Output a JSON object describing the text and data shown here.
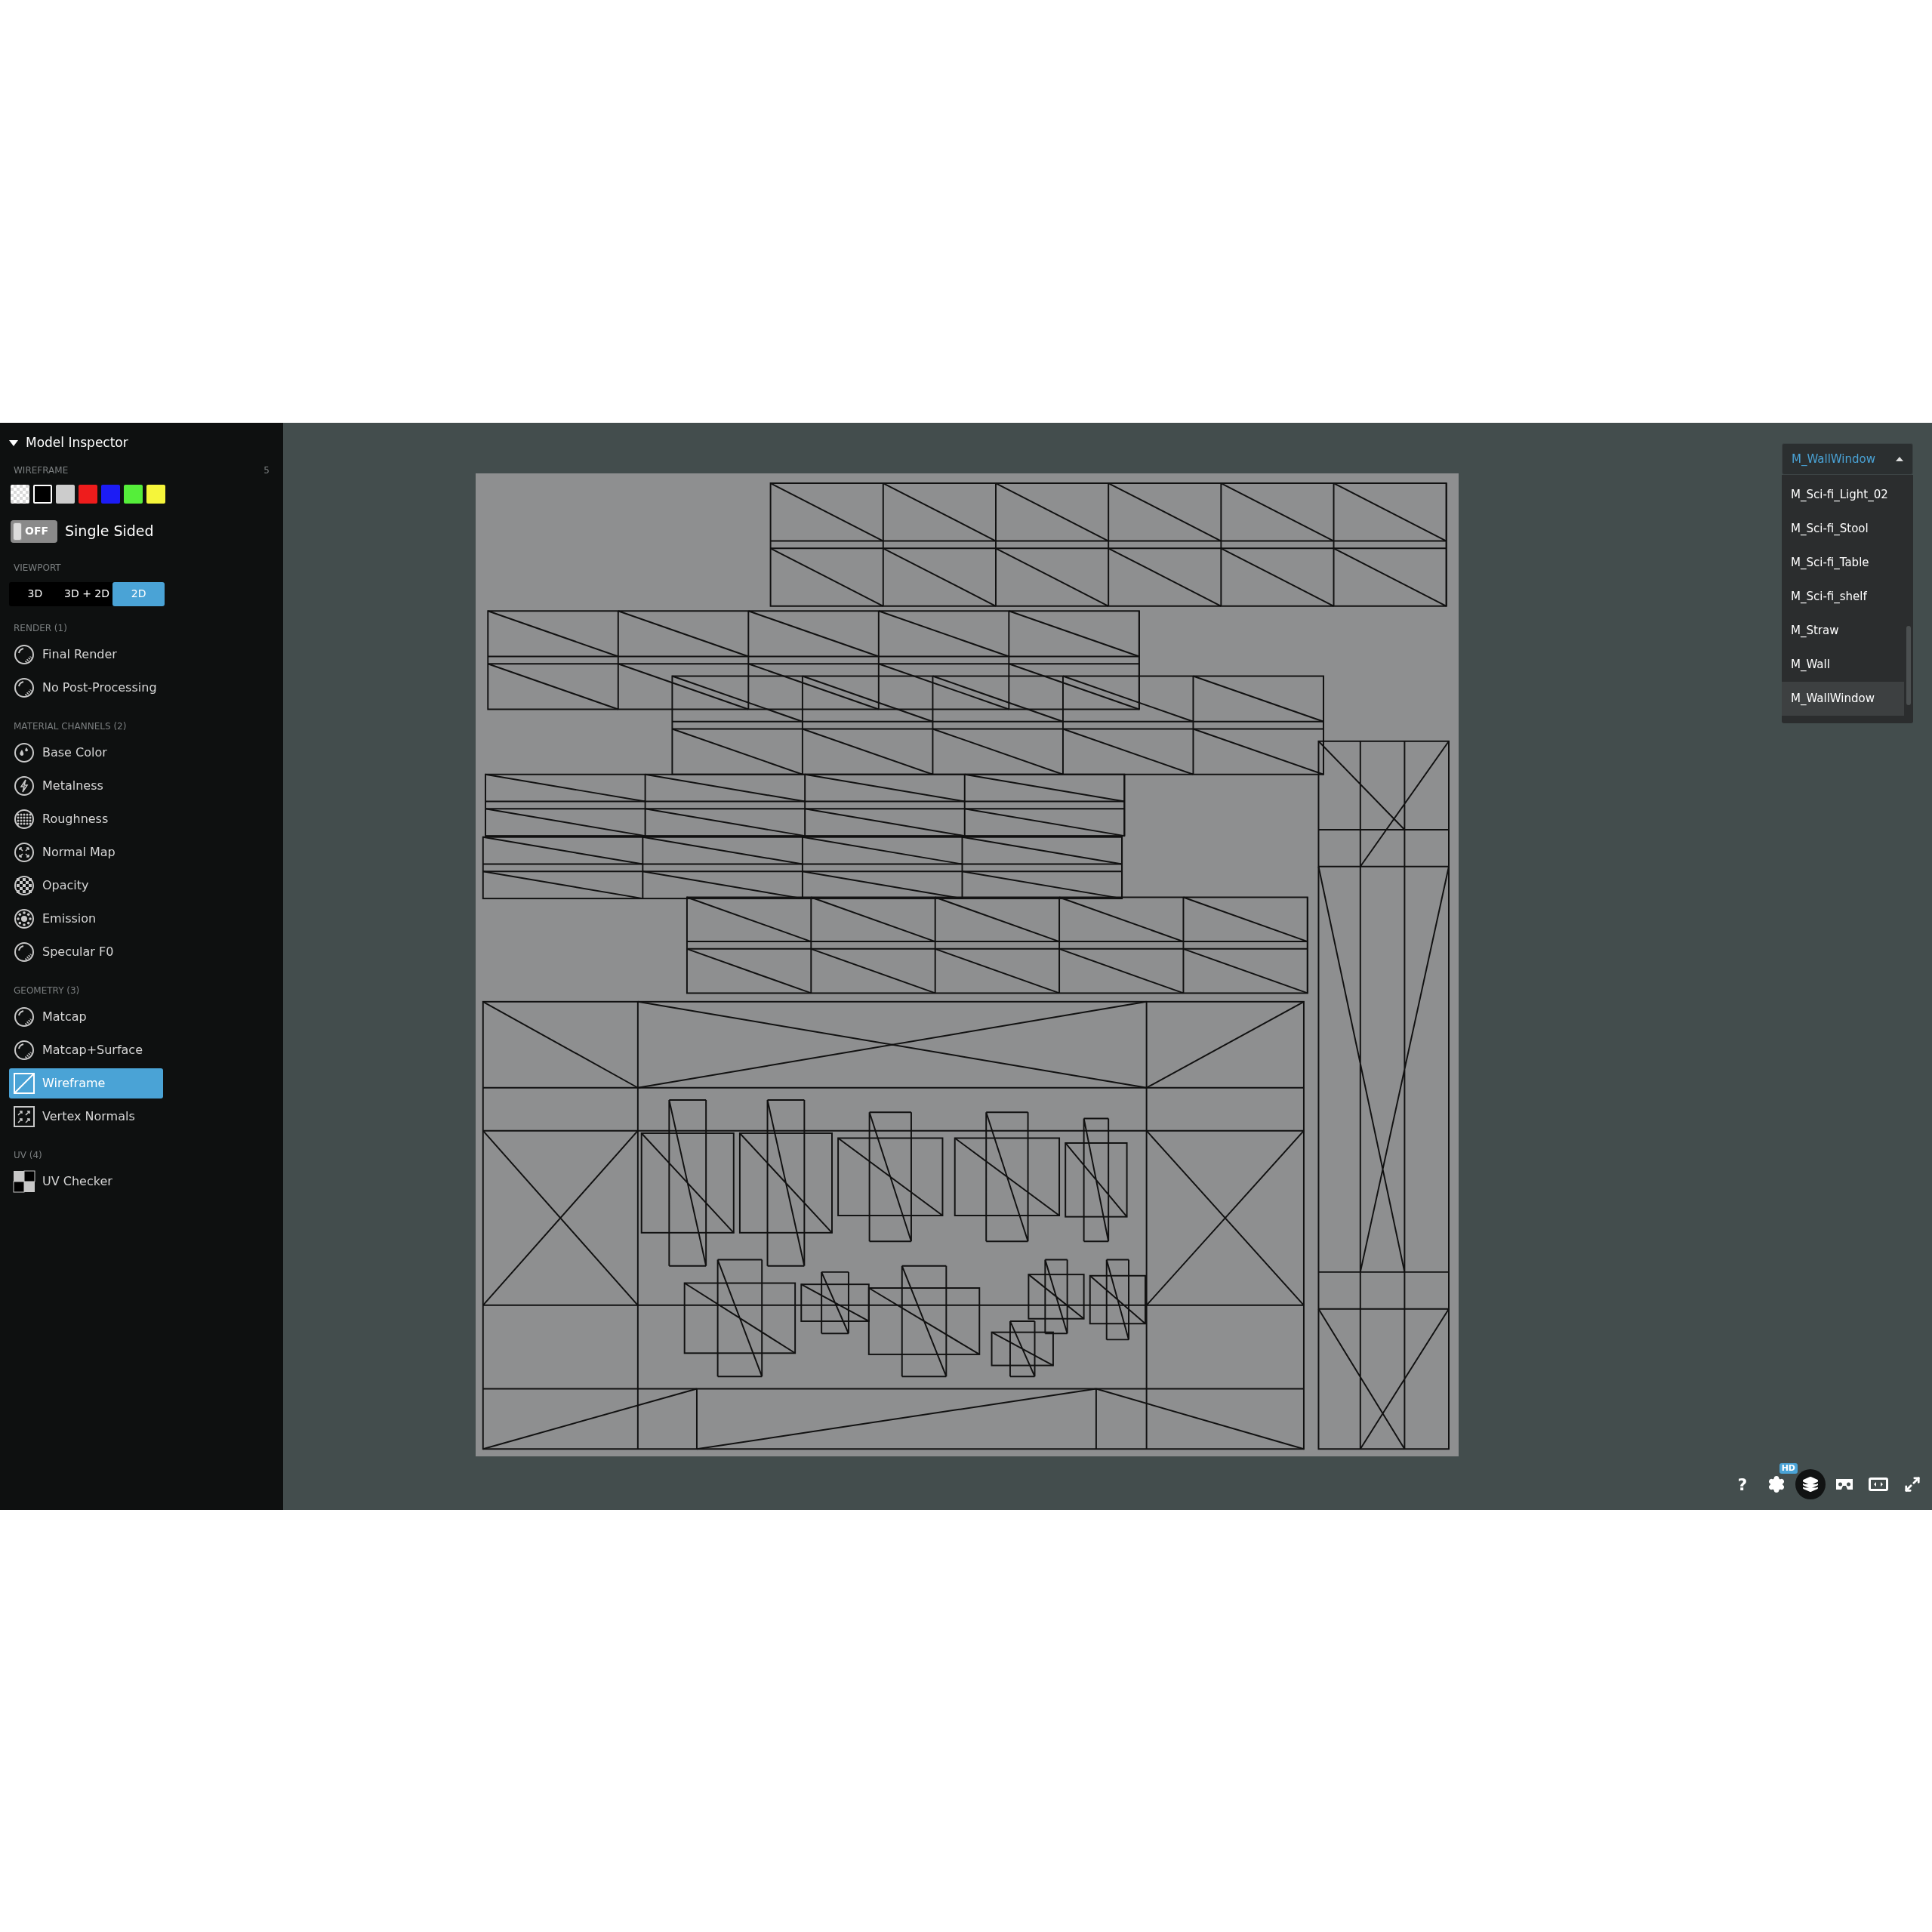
{
  "sidebar": {
    "title": "Model Inspector",
    "expanded": true,
    "wireframe": {
      "label": "WIREFRAME",
      "count": "5",
      "swatches": [
        {
          "kind": "checker",
          "selected": false
        },
        {
          "kind": "solid",
          "color": "#000000",
          "selected": true
        },
        {
          "kind": "solid",
          "color": "#cccccc",
          "selected": false
        },
        {
          "kind": "solid",
          "color": "#ee1c1c",
          "selected": false
        },
        {
          "kind": "solid",
          "color": "#1c1cf5",
          "selected": false
        },
        {
          "kind": "solid",
          "color": "#55ee3a",
          "selected": false
        },
        {
          "kind": "solid",
          "color": "#f5f53a",
          "selected": false
        }
      ]
    },
    "toggle": {
      "state": "OFF",
      "on": false,
      "label": "Single Sided"
    },
    "viewport": {
      "label": "VIEWPORT",
      "options": [
        {
          "label": "3D",
          "selected": false
        },
        {
          "label": "3D + 2D",
          "selected": false
        },
        {
          "label": "2D",
          "selected": true
        }
      ]
    },
    "sections": [
      {
        "title": "RENDER (1)",
        "items": [
          {
            "label": "Final Render",
            "kind": "sphere",
            "selected": false
          },
          {
            "label": "No Post-Processing",
            "kind": "sphere",
            "selected": false
          }
        ]
      },
      {
        "title": "MATERIAL CHANNELS (2)",
        "items": [
          {
            "label": "Base Color",
            "kind": "drops",
            "selected": false
          },
          {
            "label": "Metalness",
            "kind": "bolt",
            "selected": false
          },
          {
            "label": "Roughness",
            "kind": "dots",
            "selected": false
          },
          {
            "label": "Normal Map",
            "kind": "arrows",
            "selected": false
          },
          {
            "label": "Opacity",
            "kind": "checker",
            "selected": false
          },
          {
            "label": "Emission",
            "kind": "sun",
            "selected": false
          },
          {
            "label": "Specular F0",
            "kind": "sphere",
            "selected": false
          }
        ]
      },
      {
        "title": "GEOMETRY (3)",
        "items": [
          {
            "label": "Matcap",
            "kind": "sphere",
            "selected": false
          },
          {
            "label": "Matcap+Surface",
            "kind": "sphere",
            "selected": false
          },
          {
            "label": "Wireframe",
            "kind": "wire",
            "selected": true
          },
          {
            "label": "Vertex Normals",
            "kind": "vertex",
            "selected": false
          }
        ]
      },
      {
        "title": "UV (4)",
        "items": [
          {
            "label": "UV Checker",
            "kind": "uv",
            "selected": false
          }
        ]
      }
    ]
  },
  "material_select": {
    "value": "M_WallWindow",
    "expanded": true,
    "options": [
      {
        "label": "M_Sci-fi_Light_02",
        "selected": false
      },
      {
        "label": "M_Sci-fi_Stool",
        "selected": false
      },
      {
        "label": "M_Sci-fi_Table",
        "selected": false
      },
      {
        "label": "M_Sci-fi_shelf",
        "selected": false
      },
      {
        "label": "M_Straw",
        "selected": false
      },
      {
        "label": "M_Wall",
        "selected": false
      },
      {
        "label": "M_WallWindow",
        "selected": true
      }
    ]
  },
  "toolbar": [
    {
      "kind": "help",
      "label": "?",
      "selected": false
    },
    {
      "kind": "settings",
      "badge": "HD",
      "selected": false
    },
    {
      "kind": "layers",
      "selected": true
    },
    {
      "kind": "vr",
      "selected": false
    },
    {
      "kind": "widescreen",
      "selected": false
    },
    {
      "kind": "fullscreen",
      "selected": false
    }
  ]
}
